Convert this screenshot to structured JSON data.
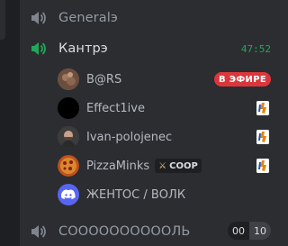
{
  "channels": [
    {
      "name": "Generalэ",
      "icon": "speaker-icon"
    },
    {
      "name": "Кантрэ",
      "icon": "speaker-icon-active",
      "timer": "47:52"
    },
    {
      "name": "СООООООООООЛЬ",
      "icon": "speaker-icon",
      "count": "00",
      "limit": "10"
    }
  ],
  "users": [
    {
      "name": "B@RS",
      "badge": "В ЭФИРЕ"
    },
    {
      "name": "Effect1ive",
      "game_icon": "game-icon"
    },
    {
      "name": "Ivan-polojenec",
      "game_icon": "game-icon"
    },
    {
      "name": "PizzaMinks",
      "tag": "COOP",
      "tag_icon": "sword-icon",
      "game_icon": "game-icon"
    },
    {
      "name": "ЖЕНТОС / ВОЛК",
      "avatar": "discord-icon"
    }
  ],
  "colors": {
    "background": "#2b2d31",
    "live": "#da373c",
    "timer": "#23a55a",
    "discord": "#5865f2"
  }
}
